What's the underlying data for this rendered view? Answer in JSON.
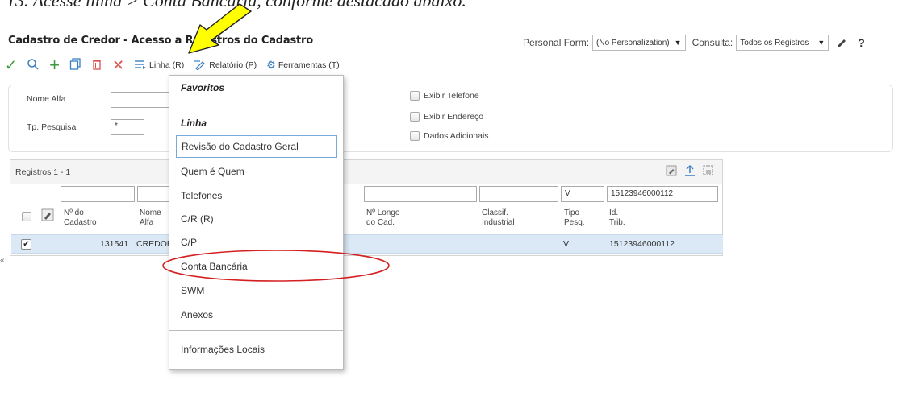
{
  "doc_caption": "13. Acesse linha > Conta Bancária, conforme destacado abaixo.",
  "window": {
    "title": "Cadastro de Credor - Acesso a Registros do Cadastro",
    "personal_form_label": "Personal Form:",
    "personal_form_value": "(No Personalization)",
    "consulta_label": "Consulta:",
    "consulta_value": "Todos os Registros",
    "help": "?"
  },
  "toolbar": {
    "linha": "Linha (R)",
    "relatorio": "Relatório (P)",
    "ferramentas": "Ferramentas (T)"
  },
  "search": {
    "nome_alfa_label": "Nome Alfa",
    "nome_alfa_value": "",
    "tp_pesquisa_label": "Tp. Pesquisa",
    "tp_pesquisa_value": "*",
    "exibir_telefone": "Exibir Telefone",
    "exibir_endereco": "Exibir Endereço",
    "dados_adicionais": "Dados Adicionais"
  },
  "grid": {
    "records": "Registros 1 - 1",
    "qbe": {
      "tipo": "V",
      "id_trib": "15123946000112"
    },
    "columns": {
      "numero": [
        "Nº do",
        "Cadastro"
      ],
      "nome": [
        "Nome",
        "Alfa"
      ],
      "longo": [
        "Nº Longo",
        "do Cad."
      ],
      "classif": [
        "Classif.",
        "Industrial"
      ],
      "tipo": [
        "Tipo",
        "Pesq."
      ],
      "id": [
        "Id.",
        "Trib."
      ]
    },
    "row": {
      "numero": "131541",
      "nome": "CREDOR T",
      "tipo": "V",
      "id": "15123946000112"
    }
  },
  "menu": {
    "favoritos": "Favoritos",
    "linha": "Linha",
    "items": [
      "Revisão do Cadastro Geral",
      "Quem é Quem",
      "Telefones",
      "C/R (R)",
      "C/P",
      "Conta Bancária",
      "SWM",
      "Anexos",
      "Informações Locais"
    ]
  },
  "colors": {
    "accent_green": "#3c9a3c",
    "accent_blue": "#3a7fc2",
    "delete_red": "#d9534f",
    "selected_row": "#dbe8f5",
    "annotation_red": "#d42020",
    "annotation_arrow": "#ffff00"
  }
}
